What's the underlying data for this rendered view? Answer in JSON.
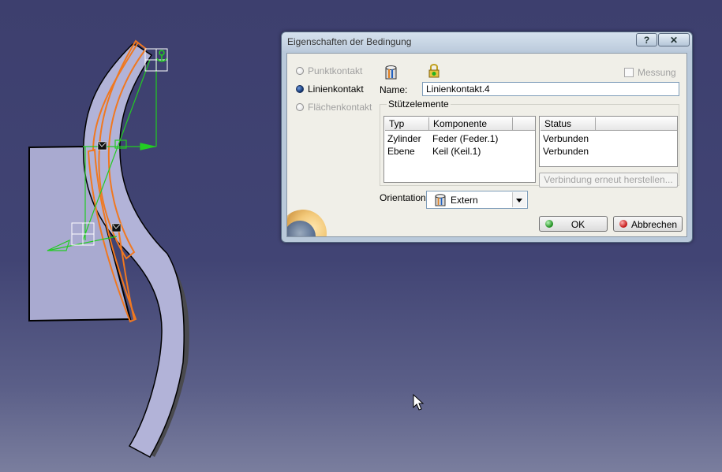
{
  "window": {
    "title": "Eigenschaften der Bedingung",
    "help_label": "?",
    "close_label": "✕"
  },
  "contact_type": {
    "options": [
      {
        "label": "Punktkontakt",
        "selected": false,
        "enabled": false
      },
      {
        "label": "Linienkontakt",
        "selected": true,
        "enabled": true
      },
      {
        "label": "Flächenkontakt",
        "selected": false,
        "enabled": false
      }
    ]
  },
  "toolbar_icons": [
    "cylinder-icon",
    "lock-icon"
  ],
  "measure": {
    "label": "Messung",
    "checked": false,
    "enabled": false
  },
  "name": {
    "label": "Name:",
    "value": "Linienkontakt.4"
  },
  "support": {
    "group_label": "Stützelemente",
    "columns": [
      "Typ",
      "Komponente"
    ],
    "rows": [
      {
        "typ": "Zylinder",
        "komponente": "Feder (Feder.1)"
      },
      {
        "typ": "Ebene",
        "komponente": "Keil (Keil.1)"
      }
    ],
    "status_header": "Status",
    "status_rows": [
      "Verbunden",
      "Verbunden"
    ],
    "reconnect_label": "Verbindung erneut herstellen..."
  },
  "orientation": {
    "label": "Orientation",
    "value": "Extern",
    "icon": "cylinder-icon"
  },
  "buttons": {
    "ok": "OK",
    "cancel": "Abbrechen"
  },
  "colors": {
    "background_top": "#3d3f6e",
    "part_fill": "#a9aad0",
    "selection_orange": "#f07820",
    "constraint_green": "#22cc22"
  }
}
